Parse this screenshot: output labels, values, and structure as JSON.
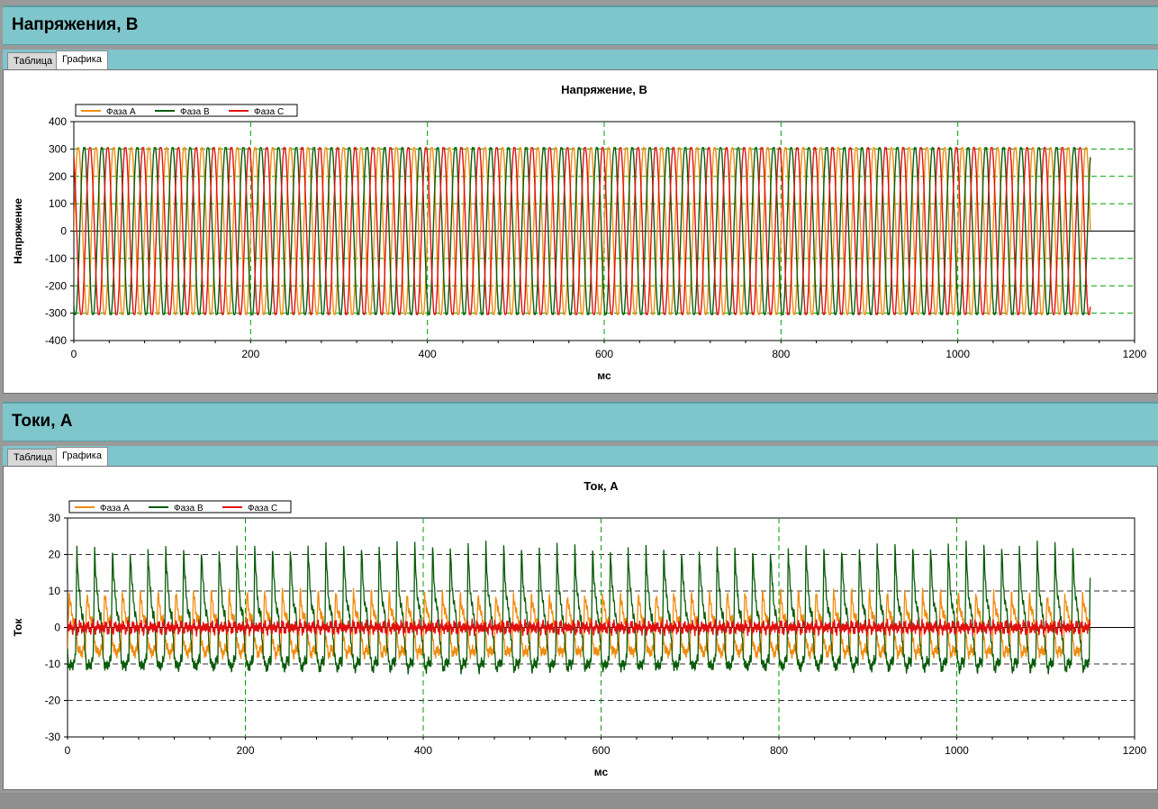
{
  "panels": [
    {
      "header": "Напряжения, В",
      "tabs": [
        "Таблица",
        "Графика"
      ],
      "active_tab": 1
    },
    {
      "header": "Токи, А",
      "tabs": [
        "Таблица",
        "Графика"
      ],
      "active_tab": 1
    }
  ],
  "colors": {
    "phase_a": "#f08c10",
    "phase_b": "#0a5c0a",
    "phase_c": "#e01010",
    "grid_x": "#00a000",
    "grid_y": "#404040"
  },
  "chart_data": [
    {
      "type": "line",
      "title": "Напряжение, В",
      "xlabel": "мс",
      "ylabel": "Напряжение",
      "xlim": [
        0,
        1200
      ],
      "ylim": [
        -400,
        400
      ],
      "xticks": [
        0,
        200,
        400,
        600,
        800,
        1000,
        1200
      ],
      "yticks": [
        400,
        300,
        200,
        100,
        0,
        -100,
        -200,
        -300,
        -400
      ],
      "grid": true,
      "legend": "top-left",
      "series": [
        {
          "name": "Фаза A",
          "color": "#f08c10",
          "model": "sine",
          "amplitude": 300,
          "frequency_hz": 50,
          "phase_deg": 0,
          "x_range": [
            0,
            1150
          ]
        },
        {
          "name": "Фаза B",
          "color": "#0a5c0a",
          "model": "sine",
          "amplitude": 300,
          "frequency_hz": 50,
          "phase_deg": -120,
          "x_range": [
            0,
            1150
          ]
        },
        {
          "name": "Фаза C",
          "color": "#e01010",
          "model": "sine",
          "amplitude": 300,
          "frequency_hz": 50,
          "phase_deg": 120,
          "x_range": [
            0,
            1150
          ]
        }
      ]
    },
    {
      "type": "line",
      "title": "Ток, А",
      "xlabel": "мс",
      "ylabel": "Ток",
      "xlim": [
        0,
        1200
      ],
      "ylim": [
        -30,
        30
      ],
      "xticks": [
        0,
        200,
        400,
        600,
        800,
        1000,
        1200
      ],
      "yticks": [
        30,
        20,
        10,
        0,
        -10,
        -20,
        -30
      ],
      "grid": true,
      "legend": "top-left",
      "series": [
        {
          "name": "Фаза A",
          "color": "#f08c10",
          "model": "pulse",
          "peak": 10,
          "trough": -7,
          "frequency_hz": 50,
          "phase_deg": 0,
          "x_range": [
            0,
            1150
          ]
        },
        {
          "name": "Фаза B",
          "color": "#0a5c0a",
          "model": "pulse",
          "peak": 22,
          "trough": -11,
          "frequency_hz": 50,
          "phase_deg": 200,
          "x_range": [
            0,
            1150
          ]
        },
        {
          "name": "Фаза C",
          "color": "#e01010",
          "model": "flat",
          "amplitude": 0.5,
          "frequency_hz": 50,
          "phase_deg": 0,
          "x_range": [
            0,
            1150
          ]
        }
      ]
    }
  ]
}
